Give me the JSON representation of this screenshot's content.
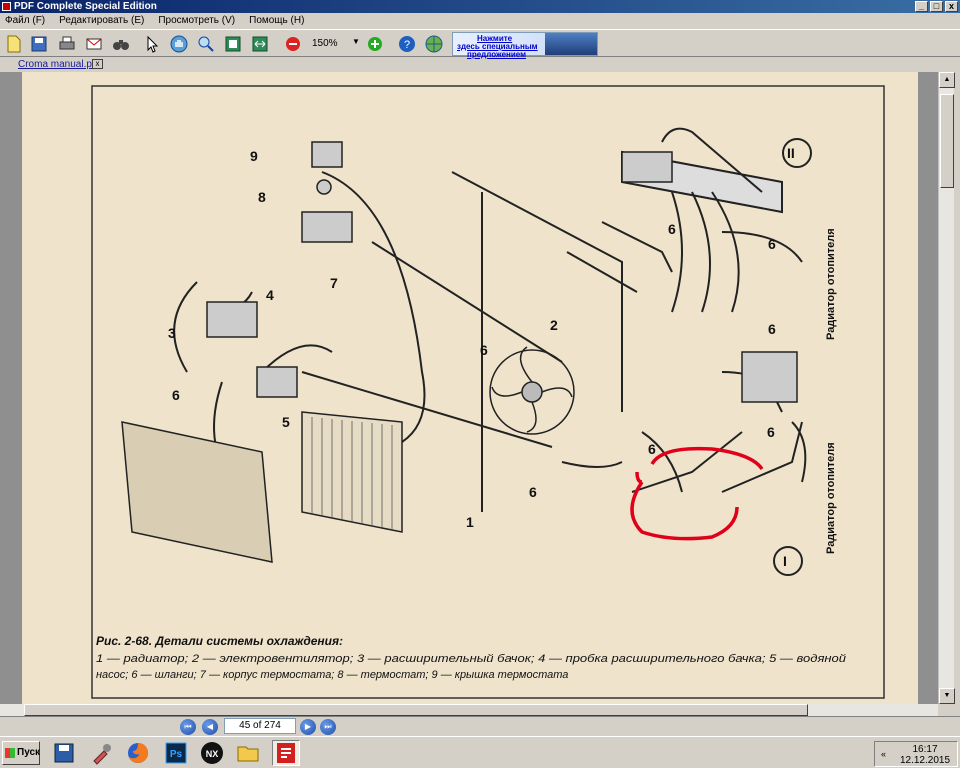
{
  "window": {
    "title": "PDF Complete Special Edition",
    "btn_min": "_",
    "btn_max": "□",
    "btn_close": "x"
  },
  "menu": [
    {
      "label": "Файл (F)"
    },
    {
      "label": "Редактировать (E)"
    },
    {
      "label": "Просмотреть (V)"
    },
    {
      "label": "Помощь (H)"
    }
  ],
  "toolbar": {
    "zoom": "150%",
    "zoom_dropdown": "▼",
    "banner_line1": "Нажмите",
    "banner_line2": "здесь специальным",
    "banner_line3": "предложением"
  },
  "tab": {
    "label": "Croma manual.pdf",
    "close": "x"
  },
  "document": {
    "diagram_labels": [
      "1",
      "2",
      "3",
      "4",
      "5",
      "6",
      "7",
      "8",
      "9",
      "I",
      "II"
    ],
    "side_label": "Радиатор отопителя",
    "caption_title": "Рис. 2-68. Детали системы охлаждения:",
    "caption_line1": "1 — радиатор; 2 — электровентилятор; 3 — расширительный бачок; 4 — пробка расширительного бачка; 5 — водяной",
    "caption_line2": "насос; 6 — шланги; 7 — корпус термостата; 8 — термостат; 9 — крышка термостата"
  },
  "navigation": {
    "page_indicator": "45 of 274"
  },
  "taskbar": {
    "start_label": "Пуск",
    "apps": [
      "save-icon",
      "tools-icon",
      "firefox-icon",
      "photoshop-icon",
      "nx-icon",
      "folder-icon",
      "pdf-app-icon"
    ],
    "ps_label": "Ps",
    "nx_label": "NX",
    "time": "16:17",
    "date": "12.12.2015",
    "tray_arrow": "«"
  },
  "colors": {
    "titlebar": "#0a246a",
    "page": "#efe3cc",
    "highlight": "#e0001a"
  }
}
